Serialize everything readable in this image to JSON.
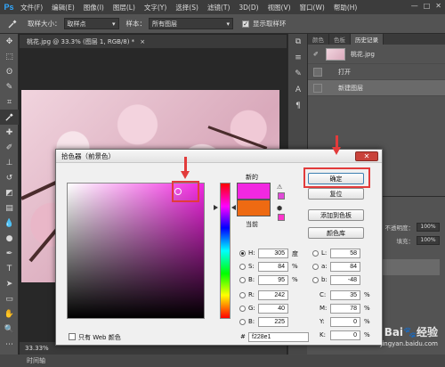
{
  "app": {
    "logo": "Ps",
    "menu": [
      "文件(F)",
      "编辑(E)",
      "图像(I)",
      "图层(L)",
      "文字(Y)",
      "选择(S)",
      "滤镜(T)",
      "3D(D)",
      "视图(V)",
      "窗口(W)",
      "帮助(H)"
    ],
    "window_controls": [
      "—",
      "□",
      "✕"
    ]
  },
  "options_bar": {
    "sample_size_label": "取样大小：",
    "sample_size_value": "取样点",
    "sample_label": "样本：",
    "sample_value": "所有图层",
    "show_ring_label": "显示取样环"
  },
  "document": {
    "tab_title": "桃花.jpg @ 33.3% (图层 1, RGB/8) *",
    "tab_close": "×",
    "zoom": "33.33%",
    "timeline_label": "时间轴"
  },
  "panels": {
    "tabs": [
      "颜色",
      "色板",
      "历史记录"
    ],
    "active_tab": "历史记录",
    "history": {
      "snapshot_name": "桃花.jpg",
      "items": [
        "打开",
        "新建图层"
      ]
    },
    "layers": {
      "opacity_label": "不透明度：",
      "opacity_value": "100%",
      "fill_label": "填充：",
      "fill_value": "100%"
    }
  },
  "color_picker": {
    "title": "拾色器（前景色）",
    "close_icon": "✕",
    "new_label": "新的",
    "current_label": "当前",
    "new_color": "#f228e1",
    "current_color": "#ee6a12",
    "buttons": {
      "ok": "确定",
      "reset": "复位",
      "add_swatch": "添加到色板",
      "libraries": "颜色库"
    },
    "hsb": [
      {
        "key": "H:",
        "value": "305",
        "unit": "度"
      },
      {
        "key": "S:",
        "value": "84",
        "unit": "%"
      },
      {
        "key": "B:",
        "value": "95",
        "unit": "%"
      }
    ],
    "rgb": [
      {
        "key": "R:",
        "value": "242"
      },
      {
        "key": "G:",
        "value": "40"
      },
      {
        "key": "B:",
        "value": "225"
      }
    ],
    "lab": [
      {
        "key": "L:",
        "value": "58"
      },
      {
        "key": "a:",
        "value": "84"
      },
      {
        "key": "b:",
        "value": "-48"
      }
    ],
    "cmyk": [
      {
        "key": "C:",
        "value": "35",
        "unit": "%"
      },
      {
        "key": "M:",
        "value": "78",
        "unit": "%"
      },
      {
        "key": "Y:",
        "value": "0",
        "unit": "%"
      },
      {
        "key": "K:",
        "value": "0",
        "unit": "%"
      }
    ],
    "hex_label": "#",
    "hex_value": "f228e1",
    "web_only_label": "只有 Web 颜色"
  },
  "watermark": {
    "text": "Bai🐾经验",
    "sub": "jingyan.baidu.com"
  },
  "accent_colors": {
    "annotation_red": "#e23b3b",
    "ps_blue": "#31a8ff"
  }
}
